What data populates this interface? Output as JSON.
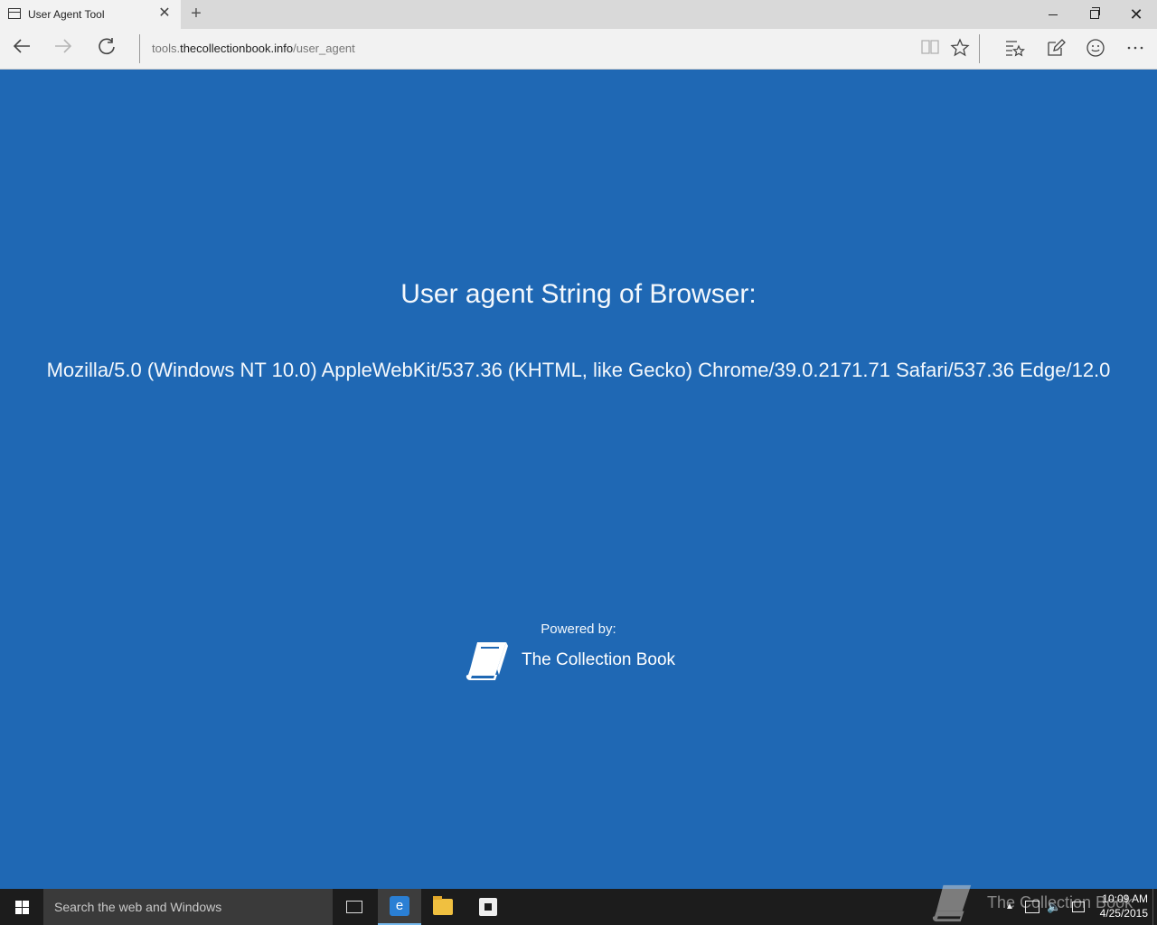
{
  "browser": {
    "tab_title": "User Agent Tool",
    "tab_close": "✕",
    "new_tab": "+",
    "address_prefix": "tools.",
    "address_host": "thecollectionbook.info",
    "address_path": "/user_agent"
  },
  "page": {
    "heading": "User agent String of Browser:",
    "user_agent": "Mozilla/5.0 (Windows NT 10.0) AppleWebKit/537.36 (KHTML, like Gecko) Chrome/39.0.2171.71 Safari/537.36 Edge/12.0",
    "powered_by": "Powered by:",
    "brand_name": "The Collection Book"
  },
  "taskbar": {
    "search_placeholder": "Search the web and Windows",
    "watermark_text": "The Collection Book",
    "time": "10:09 AM",
    "date": "4/25/2015"
  },
  "colors": {
    "page_background": "#1f68b4",
    "taskbar": "#1c1c1c",
    "chrome": "#f2f2f2"
  },
  "icons": [
    "tab-page-icon",
    "back-arrow-icon",
    "forward-arrow-icon",
    "refresh-icon",
    "reading-view-icon",
    "favorite-star-icon",
    "hub-icon",
    "web-note-icon",
    "feedback-smiley-icon",
    "more-icon",
    "windows-start-icon",
    "task-view-icon",
    "edge-icon",
    "file-explorer-icon",
    "store-icon",
    "book-logo-icon"
  ]
}
